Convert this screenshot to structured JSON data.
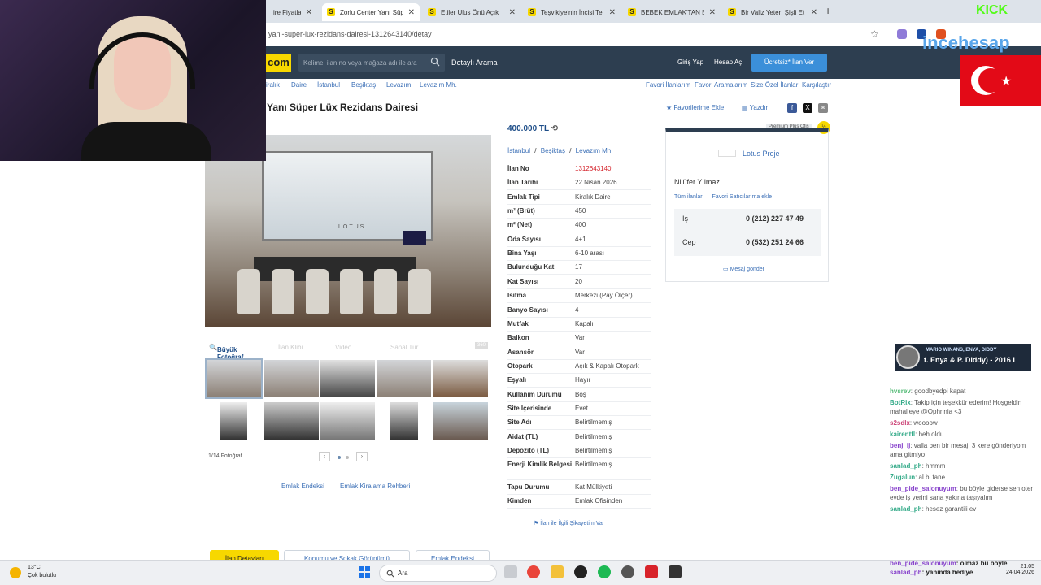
{
  "browser": {
    "tabs": [
      {
        "title": "ire Fiyatları"
      },
      {
        "title": "Zorlu Center Yanı Süp"
      },
      {
        "title": "Etiler Ulus Önü Açık"
      },
      {
        "title": "Teşvikiye'nin İncisi Te"
      },
      {
        "title": "BEBEK EMLAK'TAN Bİ"
      },
      {
        "title": "Bir Valiz Yeter; Şişli Et"
      }
    ],
    "favicon": "S",
    "new_tab": "+",
    "url": "yani-super-lux-rezidans-dairesi-1312643140/detay"
  },
  "header": {
    "logo": "com",
    "search_placeholder": "Kelime, ilan no veya mağaza adı ile ara",
    "advanced_search": "Detaylı Arama",
    "login": "Giriş Yap",
    "signup": "Hesap Aç",
    "post_ad": "Ücretsiz* İlan Ver"
  },
  "breadcrumb": [
    "iralık",
    "Daire",
    "İstanbul",
    "Beşiktaş",
    "Levazım",
    "Levazım Mh."
  ],
  "top_links": [
    "Favori İlanlarım",
    "Favori Aramalarım",
    "Size Özel İlanlar",
    "Karşılaştır"
  ],
  "listing": {
    "title": "Yanı Süper Lüx Rezidans Dairesi",
    "add_favorite": "Favorilerime Ekle",
    "print": "Yazdır",
    "price": "400.000 TL",
    "location": [
      "İstanbul",
      "Beşiktaş",
      "Levazım Mh."
    ],
    "location_separator": "/",
    "details": [
      {
        "k": "İlan No",
        "v": "1312643140",
        "highlight": true
      },
      {
        "k": "İlan Tarihi",
        "v": "22 Nisan 2026"
      },
      {
        "k": "Emlak Tipi",
        "v": "Kiralık Daire"
      },
      {
        "k": "m² (Brüt)",
        "v": "450"
      },
      {
        "k": "m² (Net)",
        "v": "400"
      },
      {
        "k": "Oda Sayısı",
        "v": "4+1"
      },
      {
        "k": "Bina Yaşı",
        "v": "6-10 arası"
      },
      {
        "k": "Bulunduğu Kat",
        "v": "17"
      },
      {
        "k": "Kat Sayısı",
        "v": "20"
      },
      {
        "k": "Isıtma",
        "v": "Merkezi (Pay Ölçer)"
      },
      {
        "k": "Banyo Sayısı",
        "v": "4"
      },
      {
        "k": "Mutfak",
        "v": "Kapalı"
      },
      {
        "k": "Balkon",
        "v": "Var"
      },
      {
        "k": "Asansör",
        "v": "Var"
      },
      {
        "k": "Otopark",
        "v": "Açık & Kapalı Otopark"
      },
      {
        "k": "Eşyalı",
        "v": "Hayır"
      },
      {
        "k": "Kullanım Durumu",
        "v": "Boş"
      },
      {
        "k": "Site İçerisinde",
        "v": "Evet"
      },
      {
        "k": "Site Adı",
        "v": "Belirtilmemiş"
      },
      {
        "k": "Aidat (TL)",
        "v": "Belirtilmemiş"
      },
      {
        "k": "Depozito (TL)",
        "v": "Belirtilmemiş"
      },
      {
        "k": "Enerji Kimlik Belgesi",
        "v": "Belirtilmemiş"
      },
      {
        "k": "Tapu Durumu",
        "v": "Kat Mülkiyeti"
      },
      {
        "k": "Kimden",
        "v": "Emlak Ofisinden"
      }
    ],
    "complaint": "İlan ile İlgili Şikayetim Var"
  },
  "gallery": {
    "photo_watermark": "LOTUS",
    "tabs": [
      "Büyük Fotoğraf",
      "İlan Klibi",
      "Video",
      "Sanal Tur",
      "360"
    ],
    "count_text": "1/14 Fotoğraf",
    "prev": "‹",
    "next": "›",
    "footer_links": [
      "Emlak Endeksi",
      "Emlak Kiralama Rehberi"
    ],
    "bottom_tabs": [
      "İlan Detayları",
      "Konumu ve Sokak Görünümü",
      "Emlak Endeksi"
    ]
  },
  "seller": {
    "premium": "Premium Plus Ofis",
    "firm": "Lotus Proje",
    "name": "Nilüfer Yılmaz",
    "all_ads": "Tüm ilanları",
    "add_favorite": "Favori Satıcılarıma ekle",
    "work_label": "İş",
    "work_phone": "0 (212) 227 47 49",
    "mobile_label": "Cep",
    "mobile_phone": "0 (532) 251 24 66",
    "send_message": "Mesaj gönder"
  },
  "overlay": {
    "brand": "incehesap",
    "kick": "KICK",
    "music_artist": "MARIO WINANS, ENYA, DIDDY",
    "music_song": "t. Enya & P. Diddy) - 2016 I",
    "chat": [
      {
        "user": "hvsrev",
        "text": ": goodbyedpi kapat"
      },
      {
        "user": "BotRix",
        "text": ": Takip için teşekkür ederim! Hoşgeldin mahalleye @Ophrinia <3"
      },
      {
        "user": "s2sdlx",
        "text": ": woooow"
      },
      {
        "user": "kairentfl",
        "text": ": heh oldu"
      },
      {
        "user": "benj_ij",
        "text": ": valla ben bir mesajı 3 kere gönderiyom ama gitmiyo"
      },
      {
        "user": "sanlad_ph",
        "text": ": hmmm"
      },
      {
        "user": "Zugalun",
        "text": ": al bi tane"
      },
      {
        "user": "ben_pide_salonuyum",
        "text": ": bu böyle giderse sen oter evde iş yerini sana yakına taşıyalım"
      },
      {
        "user": "sanlad_ph",
        "text": ": hesez garantili ev"
      }
    ],
    "chat_bottom": [
      {
        "user": "ben_pide_salonuyum",
        "text": ": olmaz bu böyle"
      },
      {
        "user": "sanlad_ph",
        "text": ": yanında hediye"
      }
    ]
  },
  "taskbar": {
    "temp": "13°C",
    "weather": "Çok bulutlu",
    "search": "Ara",
    "time": "21:05",
    "date": "24.04.2026"
  },
  "colors": {
    "accent": "#3b8fd9",
    "header_bg": "#2d3e50",
    "brand_yellow": "#f7d800",
    "highlight_red": "#d4232b"
  }
}
